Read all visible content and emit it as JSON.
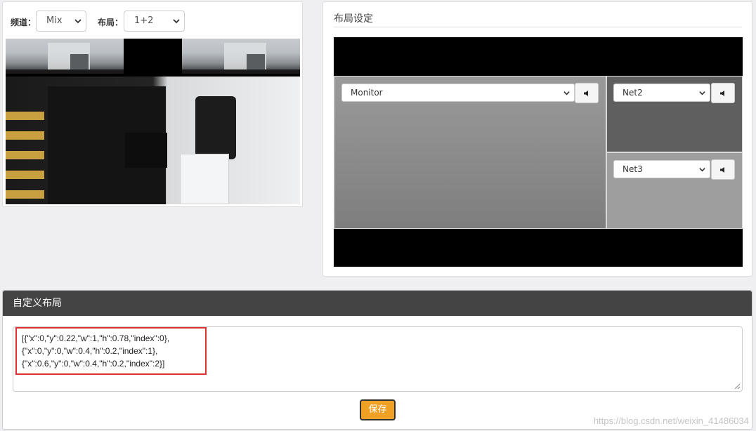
{
  "preview": {
    "channel_label": "频道：",
    "channel_value": "Mix",
    "layout_label": "布局：",
    "layout_value": "1+2"
  },
  "layout_settings": {
    "title": "布局设定",
    "regions": [
      {
        "source": "Monitor"
      },
      {
        "source": "Net2"
      },
      {
        "source": "Net3"
      }
    ]
  },
  "custom_layout": {
    "title": "自定义布局",
    "json_lines": [
      "[{\"x\":0,\"y\":0.22,\"w\":1,\"h\":0.78,\"index\":0},",
      "{\"x\":0,\"y\":0,\"w\":0.4,\"h\":0.2,\"index\":1},",
      "{\"x\":0.6,\"y\":0,\"w\":0.4,\"h\":0.2,\"index\":2}]"
    ],
    "save_label": "保存"
  },
  "watermark": "https://blog.csdn.net/weixin_41486034",
  "colors": {
    "header_bg": "#444444",
    "save_button": "#f0a023",
    "highlight": "#e03030"
  }
}
